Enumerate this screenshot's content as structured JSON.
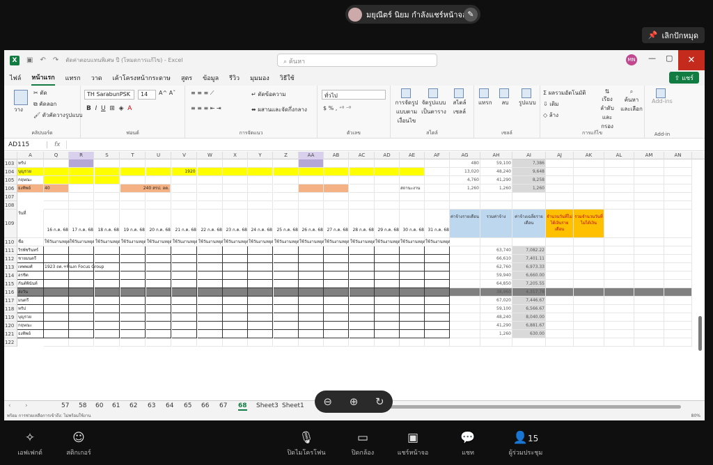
{
  "share": {
    "presenter_text": "มยุณีตร์ นิยม กำลังแชร์หน้าจอ",
    "pin_label": "เลิกปักหมุด"
  },
  "excel": {
    "title": "ตัดค่าตอบแทนพิเศษ ปี (โหมดการแก้ไข) - Excel",
    "search_placeholder": "ค้นหา",
    "user_initials": "MN",
    "share_label": "แชร์",
    "tabs": [
      "ไฟล์",
      "หน้าแรก",
      "แทรก",
      "วาด",
      "เค้าโครงหน้ากระดาษ",
      "สูตร",
      "ข้อมูล",
      "รีวิว",
      "มุมมอง",
      "วิธีใช้"
    ],
    "ribbon": {
      "clipboard": "คลิปบอร์ด",
      "font": "ฟอนต์",
      "alignment": "การจัดแนว",
      "number": "ตัวเลข",
      "styles": "สไตล์",
      "cells": "เซลล์",
      "editing": "การแก้ไข",
      "addin": "Add-in",
      "paste": "วาง",
      "cut": "ตัด",
      "copy": "คัดลอก",
      "format_painter": "ตัวคัดวางรูปแบบ",
      "font_name": "TH SarabunPSK",
      "font_size": "14",
      "wrap": "ตัดข้อความ",
      "merge": "ผสานและจัดกึ่งกลาง",
      "number_format": "ทั่วไป",
      "cond_format": "การจัดรูปแบบตามเงื่อนไข",
      "format_table": "จัดรูปแบบเป็นตาราง",
      "cell_styles": "สไตล์เซลล์",
      "insert": "แทรก",
      "delete": "ลบ",
      "format": "รูปแบบ",
      "autosum": "ผลรวมอัตโนมัติ",
      "fill": "เติม",
      "clear": "ล้าง",
      "sort": "เรียงลำดับและกรอง",
      "find": "ค้นหาและเลือก",
      "addins": "Add-ins"
    },
    "namebox": "AD115",
    "fx": "fx",
    "columns": [
      "A",
      "Q",
      "R",
      "S",
      "T",
      "U",
      "V",
      "W",
      "X",
      "Y",
      "Z",
      "AA",
      "AB",
      "AC",
      "AD",
      "AE",
      "AF",
      "AG",
      "AH",
      "AI",
      "AJ",
      "AK",
      "AL",
      "AM",
      "AN"
    ],
    "rows": [
      {
        "n": "103",
        "a": "ทรัป",
        "ag": "480",
        "ah": "59,100",
        "ai": "7,386"
      },
      {
        "n": "104",
        "a": "บุญรวย",
        "q": "1920",
        "ag": "13,020",
        "ah": "48,240",
        "ai": "9,648"
      },
      {
        "n": "105",
        "a": "กฤษณะ",
        "ag": "4,760",
        "ah": "41,290",
        "ai": "8,258"
      },
      {
        "n": "106",
        "a": "ธงทิพย์",
        "q": "40",
        "t": "240 สรป. อต.",
        "ae": "สถานะงาน",
        "ag": "1,260",
        "ah": "1,260",
        "ai": "1,260"
      },
      {
        "n": "107"
      },
      {
        "n": "108"
      },
      {
        "n": "109",
        "a": "วันที่"
      },
      {
        "n": "110",
        "a": "ชื่อ",
        "q": "ใช้วันงานหยุด"
      },
      {
        "n": "111",
        "a": "วิรพัชรินทร์",
        "ah": "63,740",
        "ai": "7,082.22"
      },
      {
        "n": "112",
        "a": "ชายมนตรี",
        "ah": "66,610",
        "ai": "7,401.11"
      },
      {
        "n": "113",
        "a": "เทพพงศ์",
        "q": "1923 ถต.+พื้นงก Focus Group",
        "ah": "62,760",
        "ai": "6,973.33"
      },
      {
        "n": "114",
        "a": "อรชิต",
        "ah": "59,940",
        "ai": "6,660.00"
      },
      {
        "n": "115",
        "a": "กันต์พินันท์",
        "ah": "64,850",
        "ai": "7,205.55"
      },
      {
        "n": "116",
        "a": "ส่งวัน",
        "ah": "38,960",
        "ai": "4,317.78"
      },
      {
        "n": "117",
        "a": "มนตรี",
        "ah": "67,020",
        "ai": "7,446.67"
      },
      {
        "n": "118",
        "a": "ทรัป",
        "ah": "59,100",
        "ai": "6,566.67"
      },
      {
        "n": "119",
        "a": "บุญรวย",
        "ah": "48,240",
        "ai": "8,040.00"
      },
      {
        "n": "120",
        "a": "กฤษณะ",
        "ah": "41,290",
        "ai": "6,881.67"
      },
      {
        "n": "121",
        "a": "ธงทิพย์",
        "ah": "1,260",
        "ai": "630.00"
      },
      {
        "n": "122"
      }
    ],
    "dates": [
      "16 ก.ค. 68",
      "17 ก.ค. 68",
      "18 ก.ค. 68",
      "19 ก.ค. 68",
      "20 ก.ค. 68",
      "21 ก.ค. 68",
      "22 ก.ค. 68",
      "23 ก.ค. 68",
      "24 ก.ค. 68",
      "25 ก.ค. 68",
      "26 ก.ค. 68",
      "27 ก.ค. 68",
      "28 ก.ค. 68",
      "29 ก.ค. 68",
      "30 ก.ค. 68",
      "31 ก.ค. 68"
    ],
    "hdr_ag": "ค่าจ้างรายเดือน",
    "hdr_ah": "รวมค่าจ้าง",
    "hdr_ai": "ค่าจ้างเฉลี่ยรายเดือน",
    "hdr_aj": "จำนวนวันที่ไม่ได้เงินรายเดือน",
    "hdr_ak": "รวมจำนวนวันที่ไม่ได้เงิน",
    "sheets": [
      "57",
      "58",
      "60",
      "61",
      "62",
      "63",
      "64",
      "65",
      "66",
      "67",
      "68",
      "Sheet3",
      "Sheet1"
    ],
    "status": "พร้อม   การช่วยเหลือการเข้าถึง: ไม่พร้อมใช้งาน",
    "zoom": "80%"
  },
  "colors": {
    "yellow": "#ffff00",
    "orange": "#f4b183",
    "purple": "#b4a7d6",
    "blue": "#bdd7ee",
    "gold": "#ffc000",
    "gray": "#808080"
  },
  "meet": {
    "effects": "เอฟเฟกต์",
    "stickers": "สติกเกอร์",
    "mic": "ปิดไมโครโฟน",
    "camera": "ปิดกล้อง",
    "share": "แชร์หน้าจอ",
    "chat": "แชท",
    "people_count": "15",
    "people": "ผู้ร่วมประชุม"
  }
}
